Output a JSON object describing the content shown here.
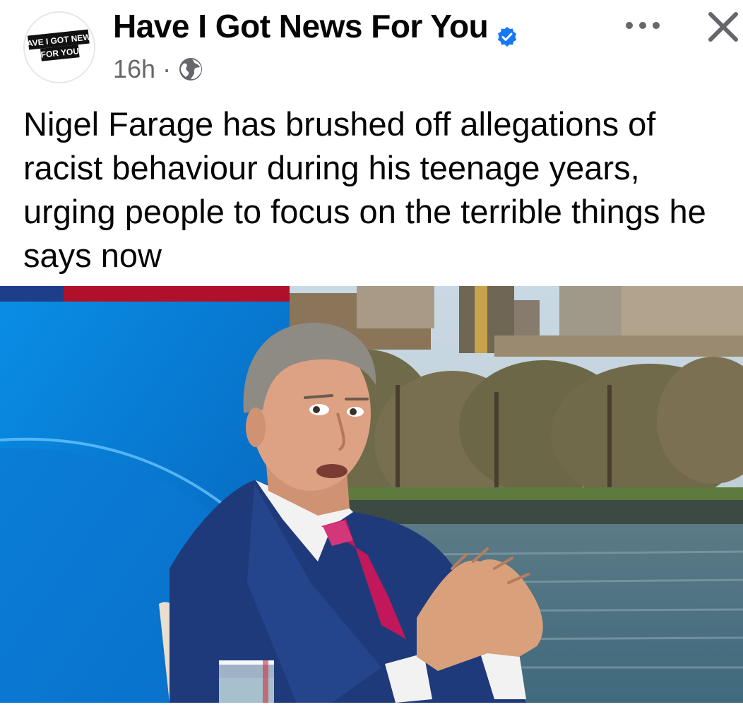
{
  "post": {
    "page_name": "Have I Got News For You",
    "verified_icon": "verified-badge-icon",
    "timestamp": "16h",
    "separator": "·",
    "audience_icon": "globe-icon",
    "text": "Nigel Farage has brushed off allegations of racist behaviour during his teenage years, urging people to focus on the terrible things he says now"
  },
  "avatar": {
    "logo_line1": "HAVE I GOT NEWS",
    "logo_line2": "FOR YOU"
  },
  "header_actions": {
    "more_icon": "more-options-icon",
    "close_icon": "close-icon"
  },
  "colors": {
    "verified_blue": "#1877f2",
    "meta_gray": "#65676b",
    "studio_blue": "#0a7fd8",
    "suit_navy": "#1f3a7a",
    "tie_pink": "#c2185b"
  }
}
